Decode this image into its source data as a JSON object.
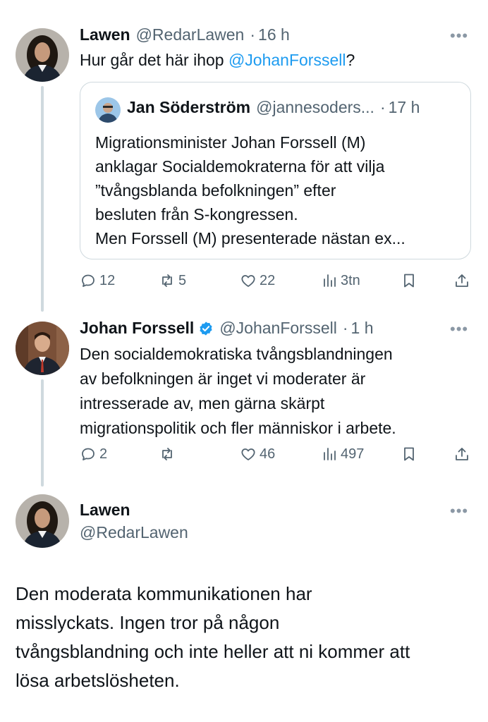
{
  "tweet1": {
    "name": "Lawen",
    "handle": "@RedarLawen",
    "time": "16 h",
    "text_before": "Hur går det här ihop ",
    "mention": "@JohanForssell",
    "text_after": "?",
    "quote": {
      "name": "Jan Söderström",
      "handle": "@jannesoders...",
      "time": "17 h",
      "lines": [
        "Migrationsminister Johan Forssell (M)",
        "anklagar Socialdemokraterna för att vilja",
        "”tvångsblanda befolkningen” efter",
        "besluten från S-kongressen.",
        "Men Forssell (M) presenterade nästan ex..."
      ]
    },
    "actions": {
      "replies": "12",
      "reposts": "5",
      "likes": "22",
      "views": "3tn"
    }
  },
  "tweet2": {
    "name": "Johan Forssell",
    "handle": "@JohanForssell",
    "time": "1 h",
    "lines": [
      "Den socialdemokratiska tvångsblandningen",
      "av befolkningen är inget vi moderater är",
      "intresserade av, men gärna skärpt",
      "migrationspolitik och fler människor i arbete."
    ],
    "actions": {
      "replies": "2",
      "reposts": "",
      "likes": "46",
      "views": "497"
    }
  },
  "tweet3": {
    "name": "Lawen",
    "handle": "@RedarLawen",
    "lines": [
      "Den moderata kommunikationen har",
      "misslyckats. Ingen tror på någon",
      "tvångsblandning och inte heller att ni kommer att",
      "lösa arbetslösheten."
    ]
  },
  "separator": "·",
  "more_label": "•••",
  "colors": {
    "accent": "#1d9bf0",
    "secondary_text": "#536471",
    "border": "#cfd9de"
  },
  "icons": [
    "reply-icon",
    "repost-icon",
    "like-icon",
    "views-icon",
    "bookmark-icon",
    "share-icon",
    "more-icon",
    "verified-badge-icon"
  ]
}
